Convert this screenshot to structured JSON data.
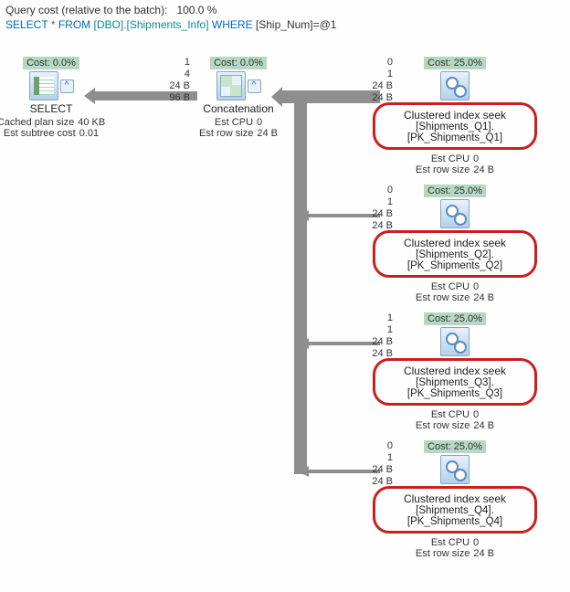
{
  "header": {
    "cost_label": "Query cost (relative to the batch):",
    "cost_value": "100.0 %",
    "sql": {
      "select": "SELECT",
      "star": "*",
      "from": "FROM",
      "obj": "[DBO].[Shipments_Info]",
      "where": "WHERE",
      "rest": "[Ship_Num]=@1"
    }
  },
  "select_node": {
    "cost": "Cost: 0.0%",
    "title": "SELECT",
    "est": [
      {
        "k": "Cached plan size",
        "v": "40 KB"
      },
      {
        "k": "Est subtree cost",
        "v": "0.01"
      }
    ]
  },
  "concat_node": {
    "cost": "Cost: 0.0%",
    "title": "Concatenation",
    "est": [
      {
        "k": "Est CPU",
        "v": "0"
      },
      {
        "k": "Est row size",
        "v": "24 B"
      }
    ],
    "side": [
      "1",
      "4",
      "24 B",
      "96 B"
    ]
  },
  "seeks": [
    {
      "cost": "Cost: 25.0%",
      "side": [
        "0",
        "1",
        "24 B",
        "24 B"
      ],
      "title": "Clustered index seek",
      "subtitle": "[Shipments_Q1].[PK_Shipments_Q1]",
      "est": [
        {
          "k": "Est CPU",
          "v": "0"
        },
        {
          "k": "Est row size",
          "v": "24 B"
        }
      ]
    },
    {
      "cost": "Cost: 25.0%",
      "side": [
        "0",
        "1",
        "24 B",
        "24 B"
      ],
      "title": "Clustered index seek",
      "subtitle": "[Shipments_Q2].[PK_Shipments_Q2]",
      "est": [
        {
          "k": "Est CPU",
          "v": "0"
        },
        {
          "k": "Est row size",
          "v": "24 B"
        }
      ]
    },
    {
      "cost": "Cost: 25.0%",
      "side": [
        "1",
        "1",
        "24 B",
        "24 B"
      ],
      "title": "Clustered index seek",
      "subtitle": "[Shipments_Q3].[PK_Shipments_Q3]",
      "est": [
        {
          "k": "Est CPU",
          "v": "0"
        },
        {
          "k": "Est row size",
          "v": "24 B"
        }
      ]
    },
    {
      "cost": "Cost: 25.0%",
      "side": [
        "0",
        "1",
        "24 B",
        "24 B"
      ],
      "title": "Clustered index seek",
      "subtitle": "[Shipments_Q4].[PK_Shipments_Q4]",
      "est": [
        {
          "k": "Est CPU",
          "v": "0"
        },
        {
          "k": "Est row size",
          "v": "24 B"
        }
      ]
    }
  ]
}
